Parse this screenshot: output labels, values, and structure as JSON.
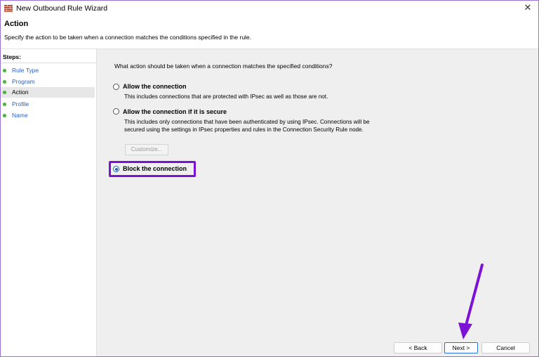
{
  "window": {
    "title": "New Outbound Rule Wizard",
    "close_glyph": "✕"
  },
  "header": {
    "title": "Action",
    "description": "Specify the action to be taken when a connection matches the conditions specified in the rule."
  },
  "steps": {
    "heading": "Steps:",
    "items": [
      {
        "label": "Rule Type",
        "active": false
      },
      {
        "label": "Program",
        "active": false
      },
      {
        "label": "Action",
        "active": true
      },
      {
        "label": "Profile",
        "active": false
      },
      {
        "label": "Name",
        "active": false
      }
    ]
  },
  "main": {
    "question": "What action should be taken when a connection matches the specified conditions?",
    "options": {
      "allow": {
        "label": "Allow the connection",
        "description": "This includes connections that are protected with IPsec as well as those are not.",
        "selected": false
      },
      "allow_secure": {
        "label": "Allow the connection if it is secure",
        "description": "This includes only connections that have been authenticated by using IPsec.  Connections will be secured using the settings in IPsec properties and rules in the Connection Security Rule node.",
        "selected": false,
        "customize_label": "Customize..."
      },
      "block": {
        "label": "Block the connection",
        "selected": true
      }
    }
  },
  "footer": {
    "back_label": "< Back",
    "next_label": "Next >",
    "cancel_label": "Cancel"
  },
  "colors": {
    "annotation": "#7b12d6",
    "step_bullet": "#4cae3c",
    "link": "#2a62c9"
  }
}
